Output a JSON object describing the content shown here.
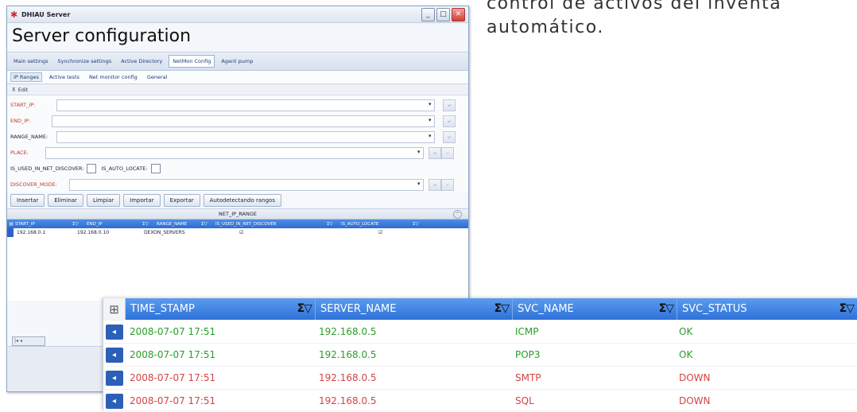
{
  "caption": {
    "line1": "control de activos del inventa",
    "line2": "automático."
  },
  "window": {
    "title": "DHIAU Server",
    "heading": "Server configuration",
    "main_tabs": [
      "Main settings",
      "Synchronize settings",
      "Active Directory",
      "NetMon Config",
      "Agent pump"
    ],
    "active_main_tab": "NetMon Config",
    "sub_tabs": [
      "IP Ranges",
      "Active tests",
      "Net monitor config",
      "General"
    ],
    "active_sub_tab": "IP Ranges",
    "edit_label": "Edit",
    "fields": {
      "start_ip": "START_IP:",
      "end_ip": "END_IP:",
      "range_name": "RANGE_NAME:",
      "place": "PLACE:",
      "is_used": "IS_USED_IN_NET_DISCOVER:",
      "is_auto": "IS_AUTO_LOCATE:",
      "discover_mode": "DISCOVER_MODE:"
    },
    "buttons": [
      "Insertar",
      "Eliminar",
      "Limpiar",
      "Importar",
      "Exportar",
      "Autodetectando rangos"
    ],
    "grid": {
      "title": "NET_IP_RANGE",
      "columns": [
        "START_IP",
        "END_IP",
        "RANGE_NAME",
        "IS_USED_IN_NET_DISCOVER",
        "IS_AUTO_LOCATE"
      ],
      "row": {
        "start_ip": "192.168.0.1",
        "end_ip": "192.168.0.10",
        "range_name": "DEXON_SERVERS",
        "is_used": "☑",
        "is_auto": "☑"
      }
    }
  },
  "service_table": {
    "columns": [
      "TIME_STAMP",
      "SERVER_NAME",
      "SVC_NAME",
      "SVC_STATUS"
    ],
    "rows": [
      {
        "time": "2008-07-07 17:51",
        "server": "192.168.0.5",
        "svc": "ICMP",
        "status": "OK",
        "state": "ok"
      },
      {
        "time": "2008-07-07 17:51",
        "server": "192.168.0.5",
        "svc": "POP3",
        "status": "OK",
        "state": "ok"
      },
      {
        "time": "2008-07-07 17:51",
        "server": "192.168.0.5",
        "svc": "SMTP",
        "status": "DOWN",
        "state": "down"
      },
      {
        "time": "2008-07-07 17:51",
        "server": "192.168.0.5",
        "svc": "SQL",
        "status": "DOWN",
        "state": "down"
      }
    ],
    "colors": {
      "ok": "#2a9d2a",
      "down": "#d34545",
      "header": "#2e72d8"
    }
  }
}
